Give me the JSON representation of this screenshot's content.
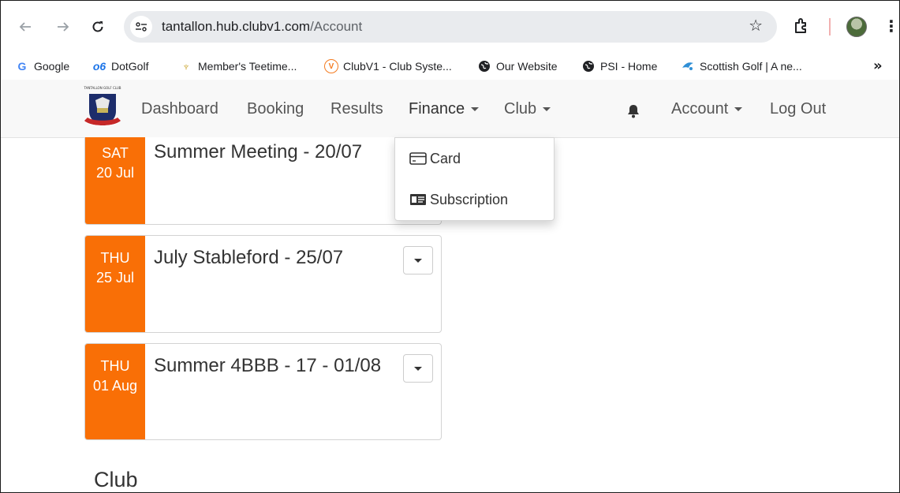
{
  "browser": {
    "url_host": "tantallon.hub.clubv1.com",
    "url_path": "/Account",
    "bookmarks": [
      {
        "label": "Google",
        "icon": "google-icon"
      },
      {
        "label": "DotGolf",
        "icon": "dotgolf-icon"
      },
      {
        "label": "Member's Teetime...",
        "icon": "teetime-icon"
      },
      {
        "label": "ClubV1 - Club Syste...",
        "icon": "clubv1-icon"
      },
      {
        "label": "Our Website",
        "icon": "globe-icon"
      },
      {
        "label": "PSI - Home",
        "icon": "globe-icon"
      },
      {
        "label": "Scottish Golf | A ne...",
        "icon": "scottish-golf-icon"
      }
    ],
    "more_bookmarks": "»"
  },
  "site": {
    "logo_text": "TANTALLON GOLF CLUB",
    "nav": {
      "dashboard": "Dashboard",
      "booking": "Booking",
      "results": "Results",
      "finance": "Finance",
      "club": "Club",
      "account": "Account",
      "logout": "Log Out"
    }
  },
  "finance_menu": {
    "items": [
      {
        "label": "Card",
        "icon": "credit-card-icon"
      },
      {
        "label": "Subscription",
        "icon": "id-card-icon"
      }
    ]
  },
  "competitions": [
    {
      "dow": "SAT",
      "date": "20 Jul",
      "title": "Summer Meeting - 20/07"
    },
    {
      "dow": "THU",
      "date": "25 Jul",
      "title": "July Stableford - 25/07"
    },
    {
      "dow": "THU",
      "date": "01 Aug",
      "title": "Summer 4BBB - 17 - 01/08"
    }
  ],
  "sections": {
    "club_title": "Club"
  },
  "colors": {
    "date_badge": "#f96f06",
    "nav_background": "#f8f8f8"
  }
}
